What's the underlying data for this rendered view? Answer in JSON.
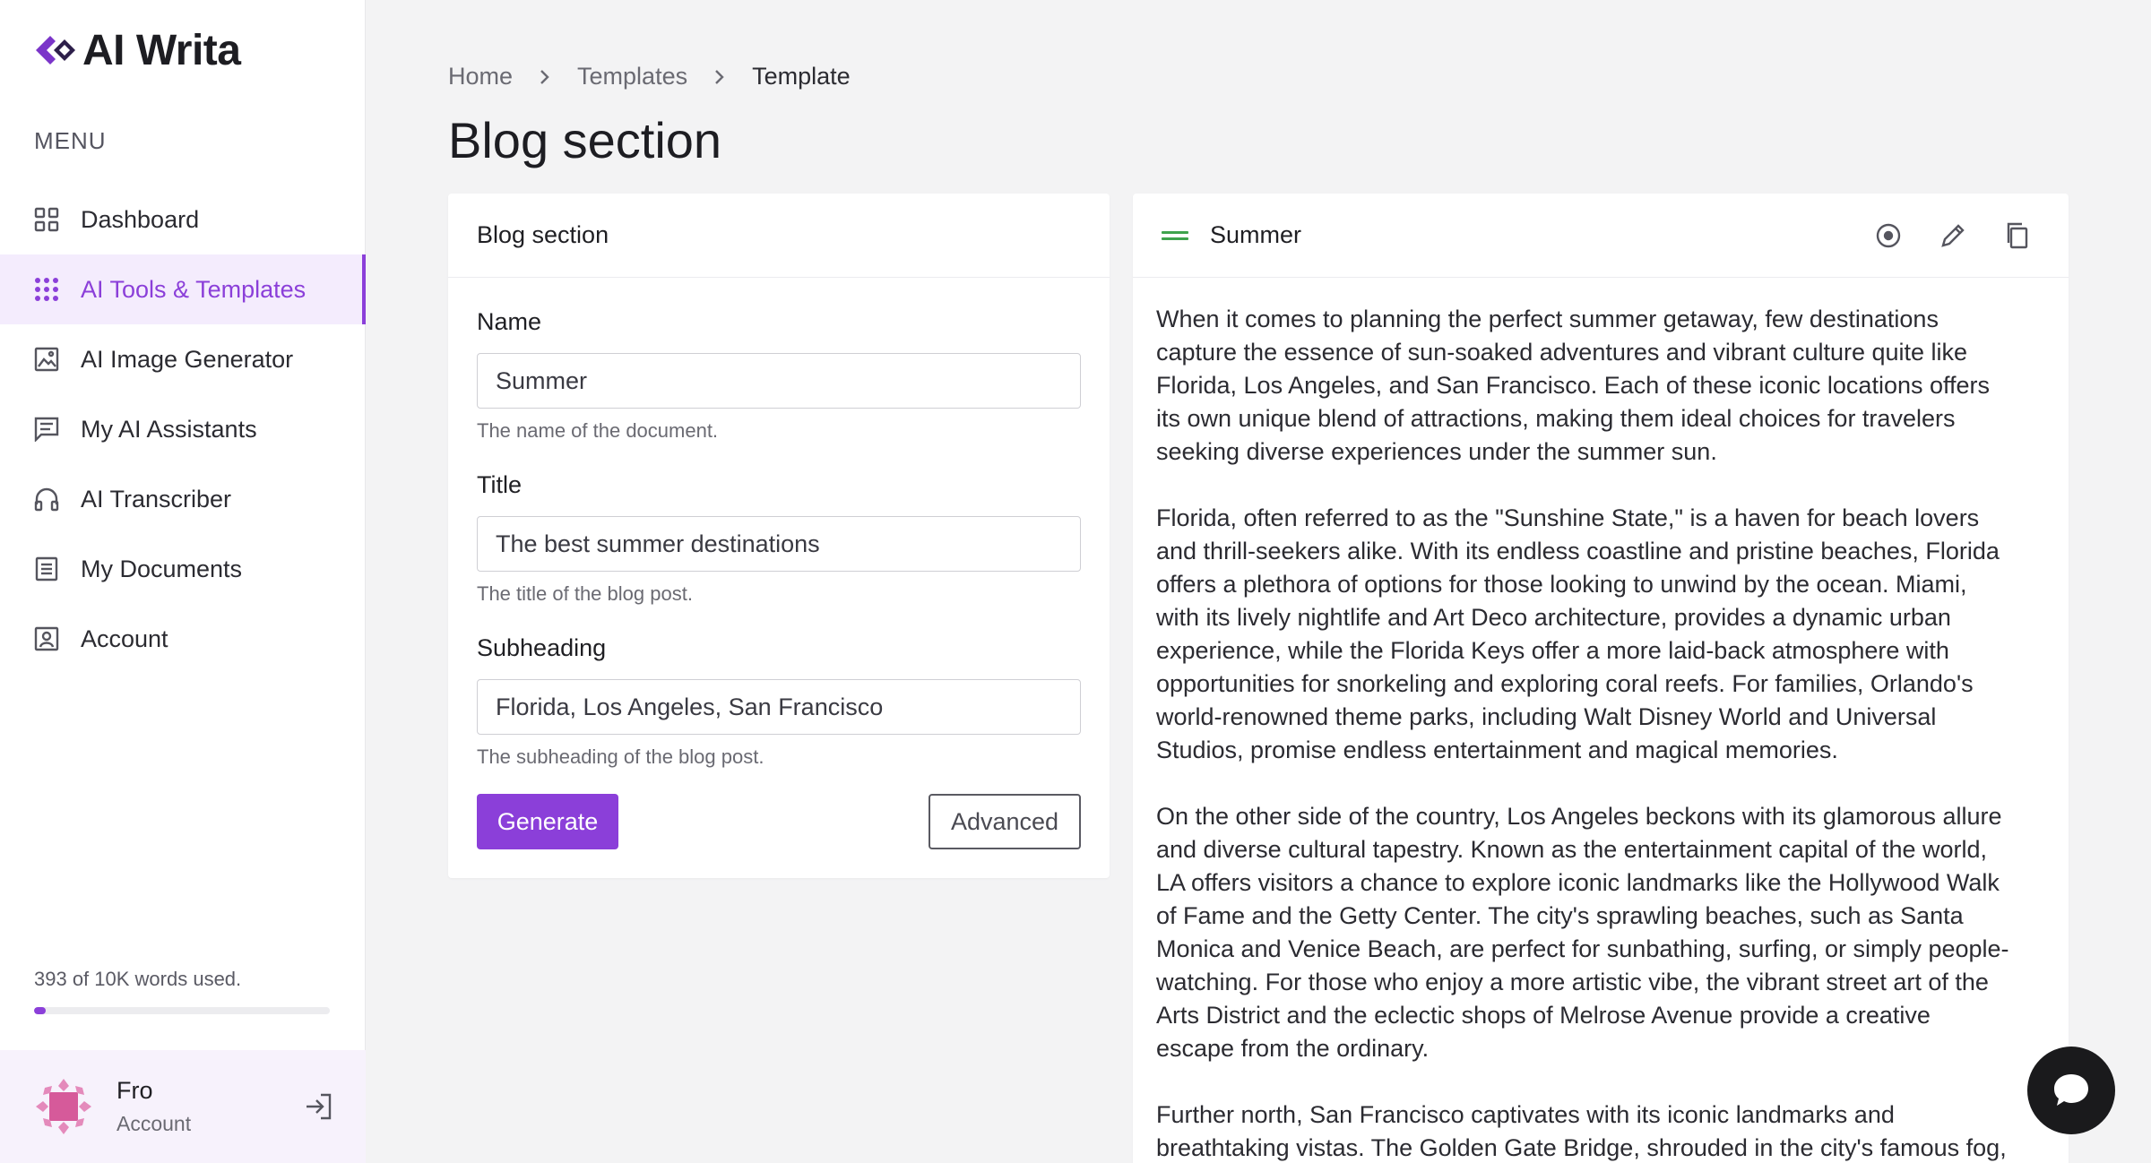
{
  "app": {
    "name": "AI Writa",
    "brand_color": "#8b3fd9"
  },
  "sidebar": {
    "menu_heading": "MENU",
    "items": [
      {
        "label": "Dashboard",
        "icon": "grid-icon",
        "active": false
      },
      {
        "label": "AI Tools & Templates",
        "icon": "apps-icon",
        "active": true
      },
      {
        "label": "AI Image Generator",
        "icon": "image-icon",
        "active": false
      },
      {
        "label": "My AI Assistants",
        "icon": "chat-icon",
        "active": false
      },
      {
        "label": "AI Transcriber",
        "icon": "headphones-icon",
        "active": false
      },
      {
        "label": "My Documents",
        "icon": "document-icon",
        "active": false
      },
      {
        "label": "Account",
        "icon": "account-icon",
        "active": false
      }
    ],
    "usage_text": "393 of 10K words used.",
    "usage_fraction": 0.0393,
    "user": {
      "name": "Fro",
      "subtitle": "Account"
    }
  },
  "breadcrumb": {
    "home": "Home",
    "templates": "Templates",
    "current": "Template"
  },
  "page_title": "Blog section",
  "form": {
    "header": "Blog section",
    "fields": {
      "name": {
        "label": "Name",
        "value": "Summer",
        "help": "The name of the document."
      },
      "title": {
        "label": "Title",
        "value": "The best summer destinations",
        "help": "The title of the blog post."
      },
      "subheading": {
        "label": "Subheading",
        "value": "Florida, Los Angeles, San Francisco",
        "help": "The subheading of the blog post."
      }
    },
    "generate_label": "Generate",
    "advanced_label": "Advanced"
  },
  "document": {
    "title": "Summer",
    "paragraphs": [
      "When it comes to planning the perfect summer getaway, few destinations\ncapture the essence of sun-soaked adventures and vibrant culture quite like\nFlorida, Los Angeles, and San Francisco. Each of these iconic locations offers\nits own unique blend of attractions, making them ideal choices for travelers\nseeking diverse experiences under the summer sun.",
      "Florida, often referred to as the \"Sunshine State,\" is a haven for beach lovers\nand thrill-seekers alike. With its endless coastline and pristine beaches, Florida\noffers a plethora of options for those looking to unwind by the ocean. Miami,\nwith its lively nightlife and Art Deco architecture, provides a dynamic urban\nexperience, while the Florida Keys offer a more laid-back atmosphere with\nopportunities for snorkeling and exploring coral reefs. For families, Orlando's\nworld-renowned theme parks, including Walt Disney World and Universal\nStudios, promise endless entertainment and magical memories.",
      "On the other side of the country, Los Angeles beckons with its glamorous allure\nand diverse cultural tapestry. Known as the entertainment capital of the world,\nLA offers visitors a chance to explore iconic landmarks like the Hollywood Walk\nof Fame and the Getty Center. The city's sprawling beaches, such as Santa\nMonica and Venice Beach, are perfect for sunbathing, surfing, or simply people-\nwatching. For those who enjoy a more artistic vibe, the vibrant street art of the\nArts District and the eclectic shops of Melrose Avenue provide a creative\nescape from the ordinary.",
      "Further north, San Francisco captivates with its iconic landmarks and\nbreathtaking vistas. The Golden Gate Bridge, shrouded in the city's famous fog,"
    ]
  }
}
